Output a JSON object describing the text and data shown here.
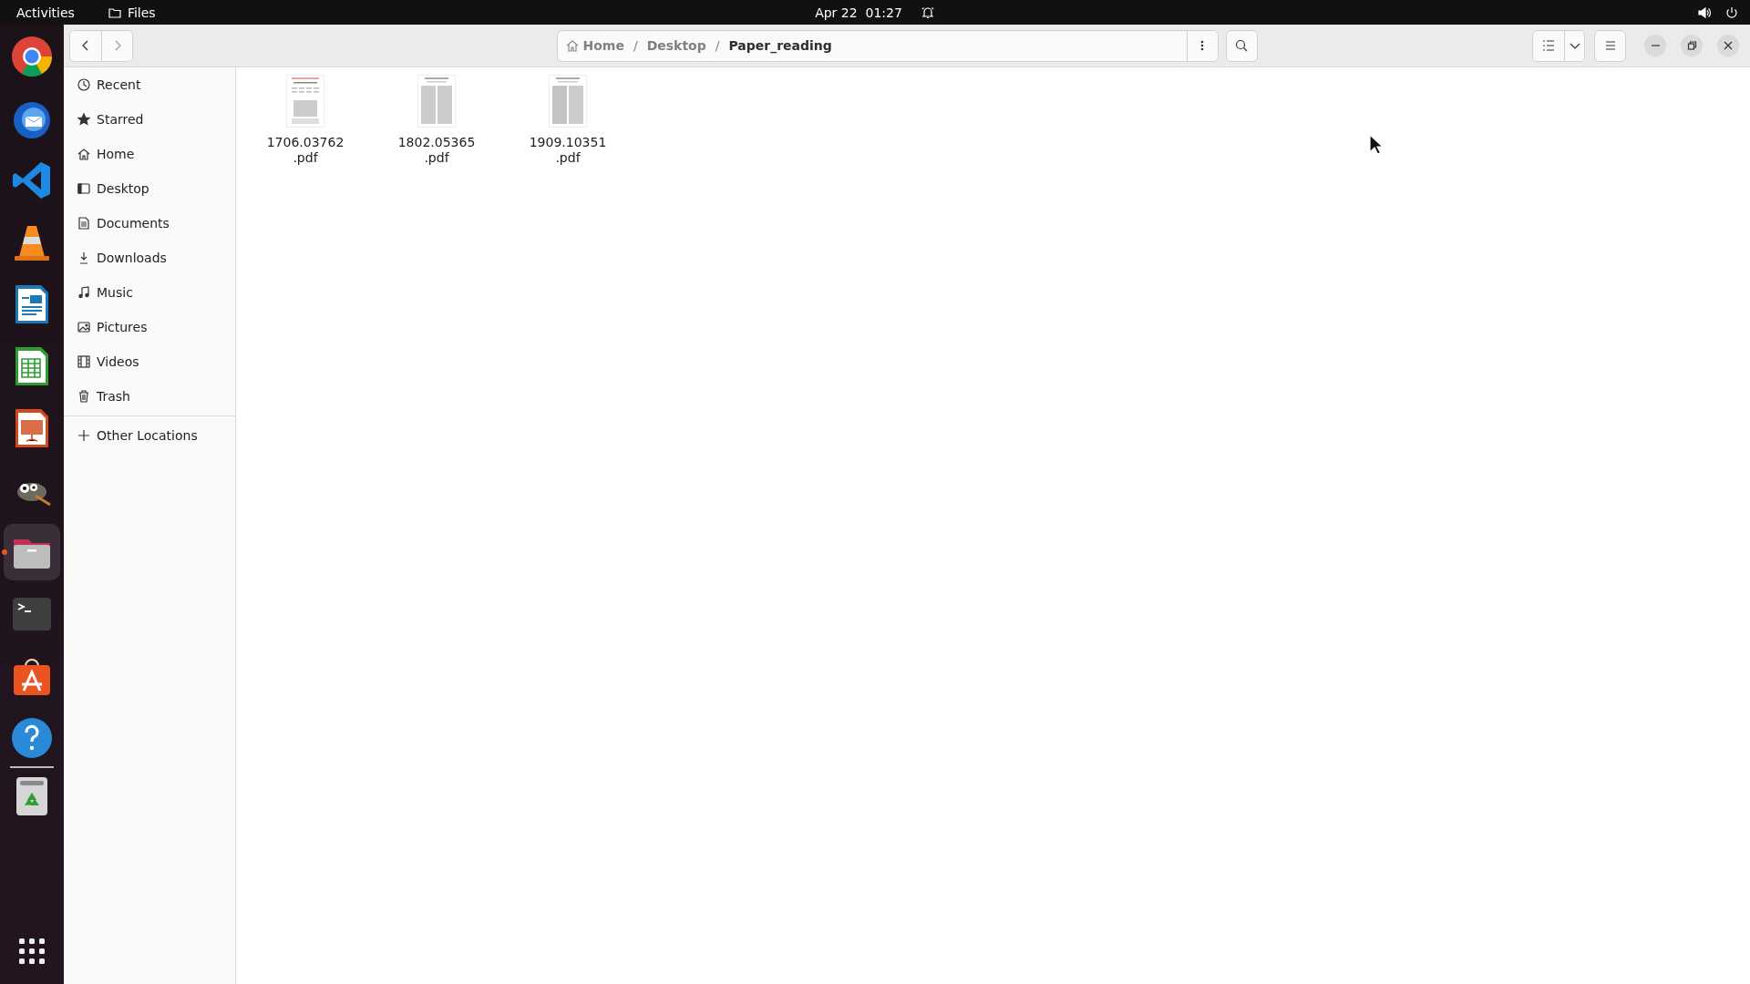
{
  "top_bar": {
    "activities": "Activities",
    "app_name": "Files",
    "clock": "Apr 22  01:27"
  },
  "dock": {
    "items": [
      {
        "kind": "browser",
        "running": false
      },
      {
        "kind": "mail",
        "running": false
      },
      {
        "kind": "code",
        "running": false
      },
      {
        "kind": "cone",
        "running": false
      },
      {
        "kind": "writer",
        "running": false
      },
      {
        "kind": "calc",
        "running": false
      },
      {
        "kind": "impress",
        "running": false
      },
      {
        "kind": "paint",
        "running": false
      },
      {
        "kind": "files",
        "running": true
      },
      {
        "kind": "terminal",
        "running": false
      },
      {
        "kind": "store",
        "running": false
      },
      {
        "kind": "help",
        "running": false
      },
      {
        "kind": "trash",
        "running": false
      }
    ]
  },
  "path_bar": {
    "segments": [
      {
        "label": "Home",
        "current": false
      },
      {
        "separator": "/",
        "label": "Desktop",
        "current": false
      },
      {
        "separator": "/",
        "label": "Paper_reading",
        "current": true
      }
    ]
  },
  "sidebar": {
    "items": [
      {
        "label": "Recent",
        "kind": "recent"
      },
      {
        "label": "Starred",
        "kind": "star"
      },
      {
        "label": "Home",
        "kind": "home"
      },
      {
        "label": "Desktop",
        "kind": "desktop"
      },
      {
        "label": "Documents",
        "kind": "document"
      },
      {
        "label": "Downloads",
        "kind": "download"
      },
      {
        "label": "Music",
        "kind": "music"
      },
      {
        "label": "Pictures",
        "kind": "picture"
      },
      {
        "label": "Videos",
        "kind": "video"
      },
      {
        "label": "Trash",
        "kind": "trash"
      }
    ],
    "other": {
      "label": "Other Locations"
    }
  },
  "files": [
    {
      "name": "1706.03762.pdf"
    },
    {
      "name": "1802.05365.pdf"
    },
    {
      "name": "1909.10351.pdf"
    }
  ]
}
